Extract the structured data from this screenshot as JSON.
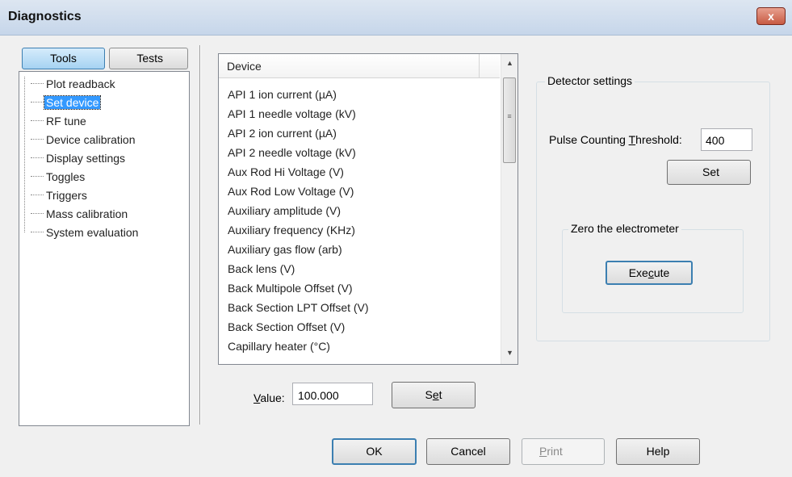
{
  "window": {
    "title": "Diagnostics",
    "close_glyph": "x"
  },
  "tabs": [
    {
      "label": "Tools",
      "active": true
    },
    {
      "label": "Tests",
      "active": false
    }
  ],
  "tree": {
    "items": [
      {
        "label": "Plot readback"
      },
      {
        "label": "Set device",
        "selected": true
      },
      {
        "label": "RF tune"
      },
      {
        "label": "Device calibration"
      },
      {
        "label": "Display settings"
      },
      {
        "label": "Toggles"
      },
      {
        "label": "Triggers"
      },
      {
        "label": "Mass calibration"
      },
      {
        "label": "System evaluation"
      }
    ]
  },
  "device_list": {
    "header": "Device",
    "items": [
      "API 1 ion current (µA)",
      "API 1 needle voltage (kV)",
      "API 2 ion current (µA)",
      "API 2 needle voltage (kV)",
      "Aux Rod Hi Voltage (V)",
      "Aux Rod Low Voltage (V)",
      "Auxiliary amplitude (V)",
      "Auxiliary frequency (KHz)",
      "Auxiliary gas flow (arb)",
      "Back lens (V)",
      "Back Multipole Offset (V)",
      "Back Section LPT Offset (V)",
      "Back Section Offset (V)",
      "Capillary heater (°C)"
    ],
    "scroll_up": "▲",
    "scroll_down": "▼",
    "grip": "≡"
  },
  "value": {
    "label_pre": "",
    "label_ul": "V",
    "label_post": "alue:",
    "input": "100.000"
  },
  "set_button": {
    "pre": "S",
    "ul": "e",
    "post": "t"
  },
  "detector": {
    "title": "Detector settings",
    "threshold_pre": "Pulse Counting ",
    "threshold_ul": "T",
    "threshold_post": "hreshold:",
    "threshold_value": "400",
    "set_label": "Set"
  },
  "zero": {
    "title": "Zero the electrometer",
    "execute_pre": "Exe",
    "execute_ul": "c",
    "execute_post": "ute"
  },
  "footer": {
    "ok": "OK",
    "cancel": "Cancel",
    "print_ul": "P",
    "print_post": "rint",
    "print_enabled": false,
    "help": "Help"
  },
  "colors": {
    "selection": "#3399ff",
    "accent_border": "#3c7fb1",
    "title_bar": "#c6d6ea",
    "close": "#c75a43"
  }
}
